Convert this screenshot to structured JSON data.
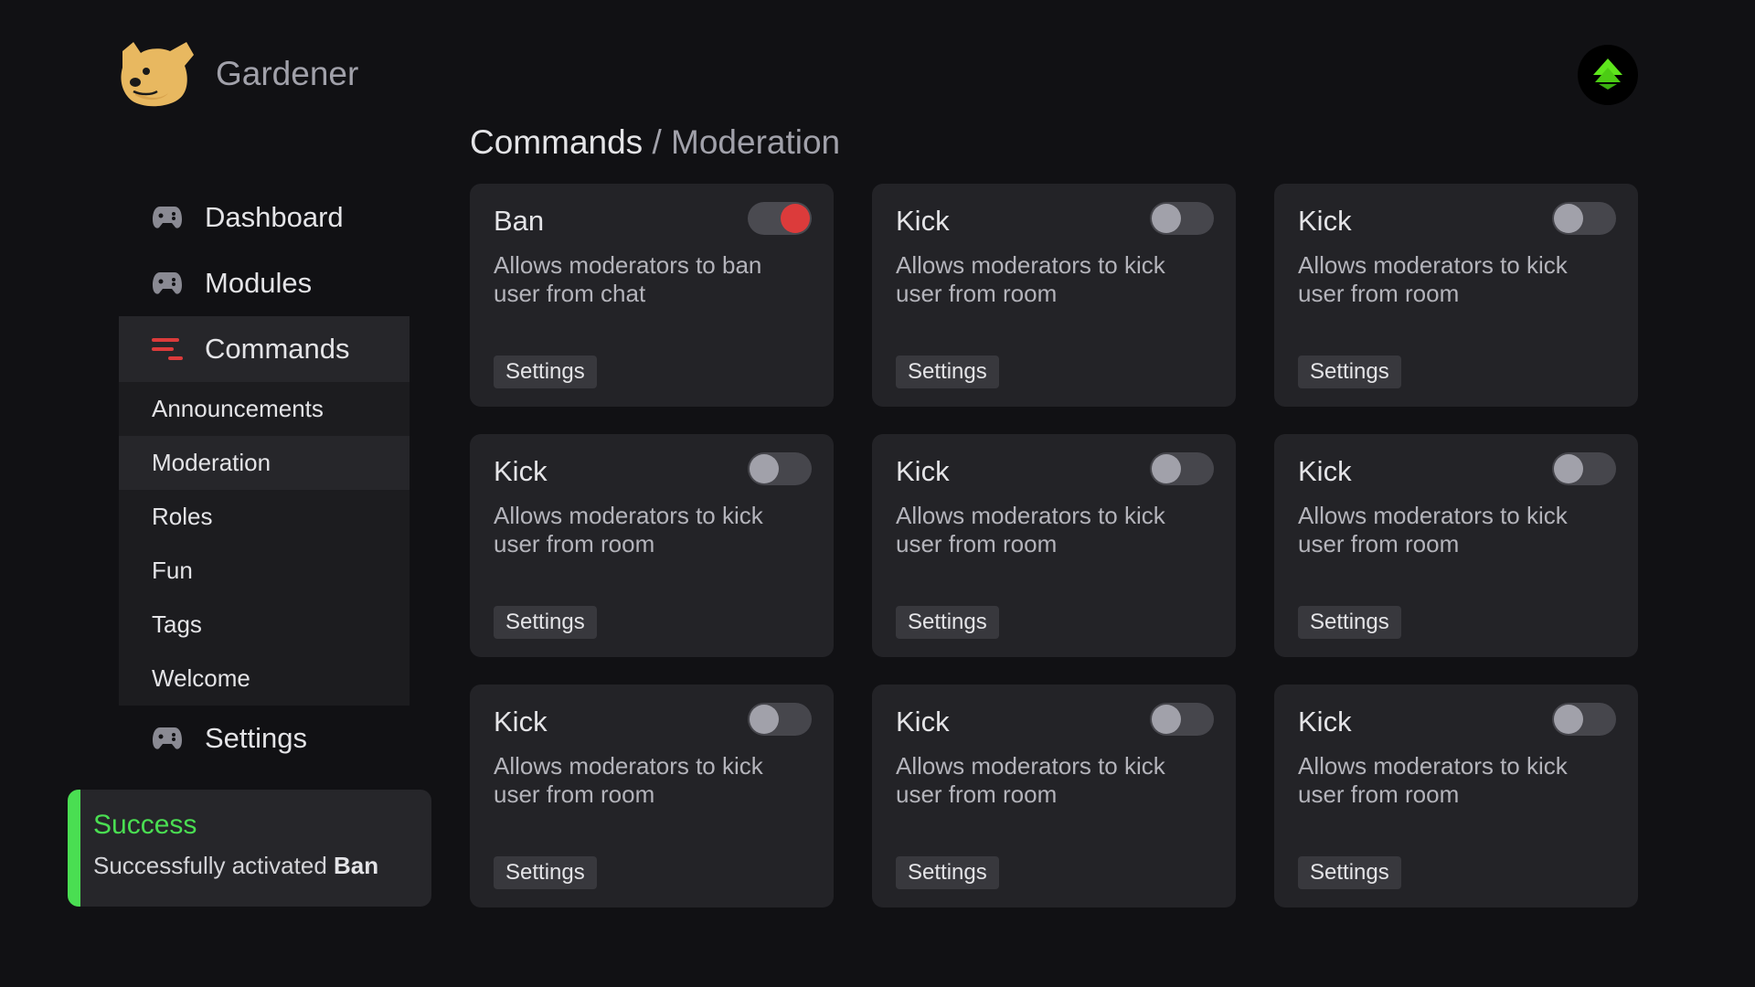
{
  "app": {
    "name": "Gardener"
  },
  "breadcrumb": {
    "root": "Commands",
    "separator": "/",
    "current": "Moderation"
  },
  "sidebar": {
    "items": [
      {
        "label": "Dashboard",
        "icon": "gamepad-icon"
      },
      {
        "label": "Modules",
        "icon": "gamepad-icon"
      },
      {
        "label": "Commands",
        "icon": "menu-lines-icon",
        "active": true
      },
      {
        "label": "Settings",
        "icon": "gamepad-icon"
      }
    ],
    "subitems": [
      {
        "label": "Announcements"
      },
      {
        "label": "Moderation",
        "active": true
      },
      {
        "label": "Roles"
      },
      {
        "label": "Fun"
      },
      {
        "label": "Tags"
      },
      {
        "label": "Welcome"
      }
    ]
  },
  "toast": {
    "title": "Success",
    "message": "Successfully activated",
    "emphasis": "Ban"
  },
  "cards": [
    {
      "title": "Ban",
      "desc": "Allows moderators to ban user from chat",
      "button": "Settings",
      "enabled": true
    },
    {
      "title": "Kick",
      "desc": "Allows moderators to kick user from room",
      "button": "Settings",
      "enabled": false
    },
    {
      "title": "Kick",
      "desc": "Allows moderators to kick user from room",
      "button": "Settings",
      "enabled": false
    },
    {
      "title": "Kick",
      "desc": "Allows moderators to kick user from room",
      "button": "Settings",
      "enabled": false
    },
    {
      "title": "Kick",
      "desc": "Allows moderators to kick user from room",
      "button": "Settings",
      "enabled": false
    },
    {
      "title": "Kick",
      "desc": "Allows moderators to kick user from room",
      "button": "Settings",
      "enabled": false
    },
    {
      "title": "Kick",
      "desc": "Allows moderators to kick user from room",
      "button": "Settings",
      "enabled": false
    },
    {
      "title": "Kick",
      "desc": "Allows moderators to kick user from room",
      "button": "Settings",
      "enabled": false
    },
    {
      "title": "Kick",
      "desc": "Allows moderators to kick user from room",
      "button": "Settings",
      "enabled": false
    }
  ],
  "colors": {
    "accent": "#dc3b3b",
    "success": "#4ade52",
    "background": "#111114",
    "card": "#232327",
    "avatar_logo": "#5ee61c"
  }
}
